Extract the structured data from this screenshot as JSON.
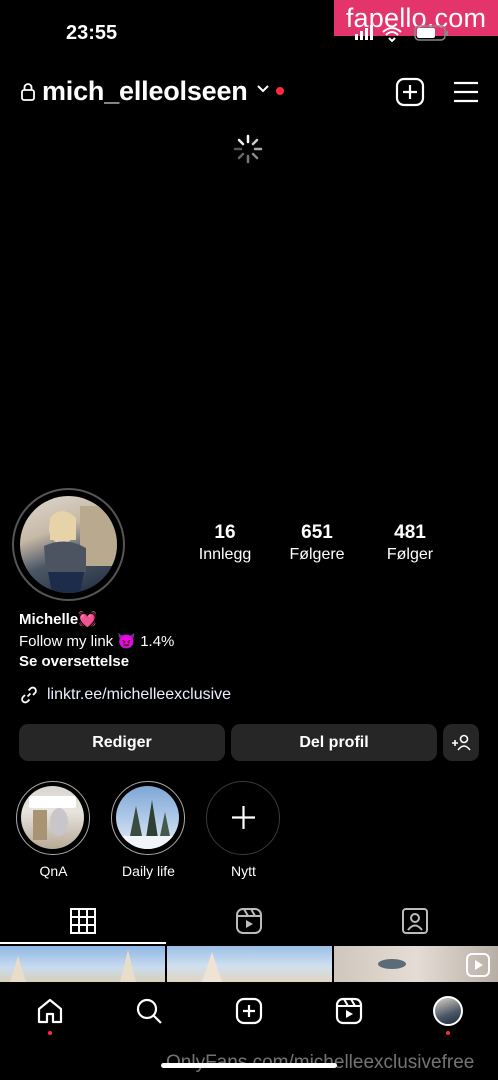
{
  "watermark_top": "fapello.com",
  "watermark_bottom": "OnlyFans.com/michelleexclusivefree",
  "status_bar": {
    "time": "23:55",
    "icons": [
      "signal-icon",
      "wifi-icon",
      "battery-icon"
    ]
  },
  "header": {
    "username": "mich_elleolseen",
    "icons": [
      "lock-icon",
      "chevron-down-icon",
      "new-post-icon",
      "menu-icon"
    ],
    "notification_color": "#ff2a3d"
  },
  "profile": {
    "stats": [
      {
        "value": "16",
        "label": "Innlegg"
      },
      {
        "value": "651",
        "label": "Følgere"
      },
      {
        "value": "481",
        "label": "Følger"
      }
    ],
    "name": "Michelle💓",
    "bio": "Follow my link 😈 1.4%",
    "translate": "Se oversettelse",
    "link": "linktr.ee/michelleexclusive"
  },
  "buttons": {
    "edit": "Rediger",
    "share": "Del profil"
  },
  "highlights": [
    {
      "label": "QnA"
    },
    {
      "label": "Daily life"
    },
    {
      "label": "Nytt"
    }
  ],
  "tabs": [
    "grid-icon",
    "reels-icon",
    "tagged-icon"
  ],
  "bottom_nav": [
    "home-icon",
    "search-icon",
    "create-icon",
    "reels-icon",
    "profile-avatar"
  ]
}
